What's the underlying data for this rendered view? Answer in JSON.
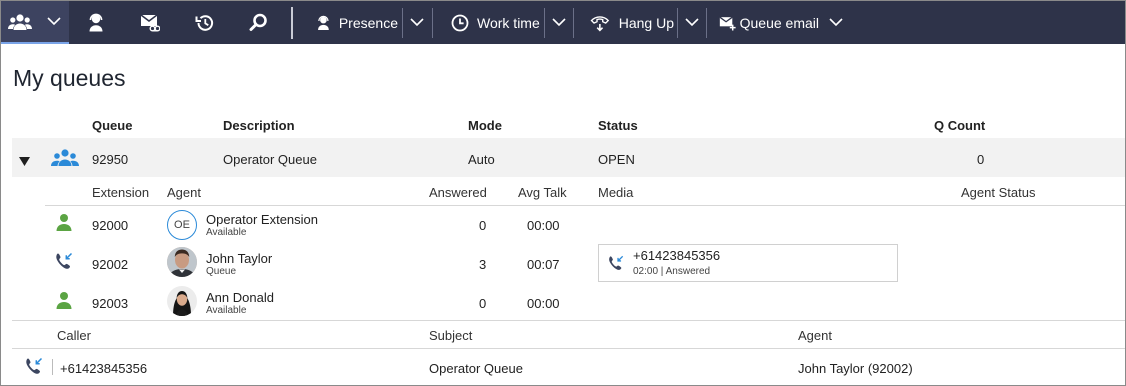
{
  "toolbar": {
    "presence_label": "Presence",
    "worktime_label": "Work time",
    "hangup_label": "Hang Up",
    "queue_email_label": "Queue email"
  },
  "page": {
    "title": "My queues"
  },
  "queue_table": {
    "headers": {
      "queue": "Queue",
      "description": "Description",
      "mode": "Mode",
      "status": "Status",
      "q_count": "Q Count"
    },
    "row": {
      "queue": "92950",
      "description": "Operator Queue",
      "mode": "Auto",
      "status": "OPEN",
      "q_count": "0"
    }
  },
  "agent_table": {
    "headers": {
      "extension": "Extension",
      "agent": "Agent",
      "answered": "Answered",
      "avg_talk": "Avg Talk",
      "media": "Media",
      "agent_status": "Agent Status"
    },
    "rows": [
      {
        "extension": "92000",
        "initials": "OE",
        "name": "Operator Extension",
        "presence": "Available",
        "answered": "0",
        "avg_talk": "00:00",
        "icon": "person-available-icon"
      },
      {
        "extension": "92002",
        "name": "John Taylor",
        "presence": "Queue",
        "answered": "3",
        "avg_talk": "00:07",
        "icon": "phone-incoming-icon",
        "media": {
          "number": "+61423845356",
          "detail": "02:00 | Answered"
        }
      },
      {
        "extension": "92003",
        "name": "Ann Donald",
        "presence": "Available",
        "answered": "0",
        "avg_talk": "00:00",
        "icon": "person-available-icon"
      }
    ]
  },
  "calls_table": {
    "headers": {
      "caller": "Caller",
      "subject": "Subject",
      "agent": "Agent"
    },
    "rows": [
      {
        "caller": "+61423845356",
        "subject": "Operator Queue",
        "agent": "John Taylor (92002)"
      }
    ]
  },
  "colors": {
    "toolbar_bg": "#2e3349",
    "accent_blue": "#2b8ad8",
    "available_green": "#5ba443",
    "row_bg": "#f2f2f2"
  }
}
